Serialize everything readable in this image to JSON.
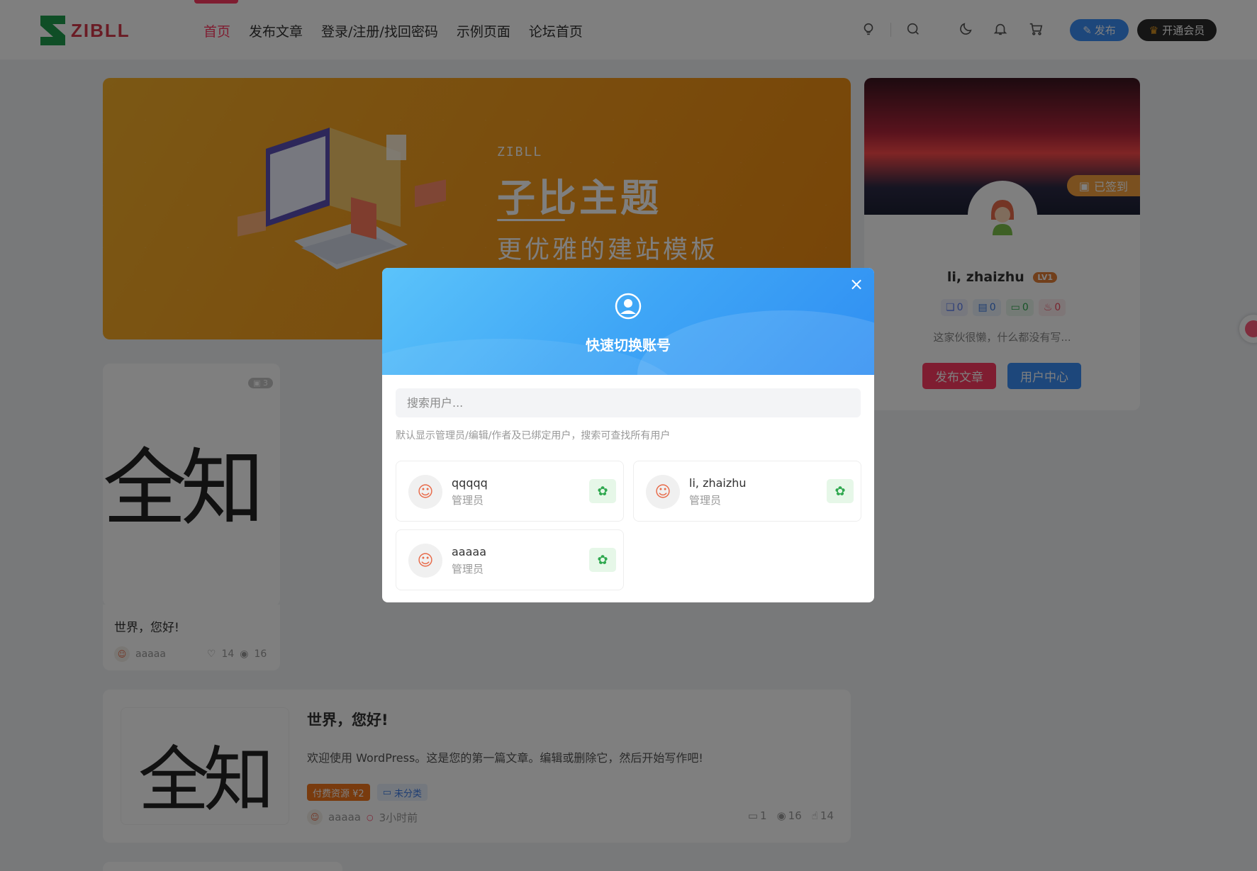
{
  "header": {
    "logo_text": "ZIBLL",
    "nav": [
      {
        "label": "首页",
        "active": true
      },
      {
        "label": "发布文章",
        "active": false
      },
      {
        "label": "登录/注册/找回密码",
        "active": false
      },
      {
        "label": "示例页面",
        "active": false
      },
      {
        "label": "论坛首页",
        "active": false
      }
    ],
    "publish_label": "发布",
    "vip_label": "开通会员",
    "icons": [
      "lightbulb-icon",
      "search-icon",
      "moon-icon",
      "bell-icon",
      "cart-icon"
    ]
  },
  "banner": {
    "brand": "ZIBLL",
    "title": "子比主题",
    "subtitle": "更优雅的建站模板"
  },
  "profile": {
    "checked_in_label": "已签到",
    "name": "li, zhaizhu",
    "level": "LV1",
    "stats": [
      {
        "icon": "comments-icon",
        "value": "0",
        "color": "#5b7cf0",
        "bg": "#eef1fd"
      },
      {
        "icon": "document-icon",
        "value": "0",
        "color": "#3d7be5",
        "bg": "#eaf2fd"
      },
      {
        "icon": "message-icon",
        "value": "0",
        "color": "#2fa84f",
        "bg": "#e8f6ec"
      },
      {
        "icon": "fire-icon",
        "value": "0",
        "color": "#ef4a5e",
        "bg": "#fdecef"
      }
    ],
    "description": "这家伙很懒，什么都没有写...",
    "publish_button": "发布文章",
    "user_center_button": "用户中心"
  },
  "post_card_vertical": {
    "image_count": "3",
    "image_text": "全知",
    "title": "世界，您好!",
    "author": "aaaaa",
    "likes": "14",
    "views": "16"
  },
  "post_card_horizontal": {
    "image_text": "全知",
    "title": "世界，您好!",
    "excerpt": "欢迎使用 WordPress。这是您的第一篇文章。编辑或删除它，然后开始写作吧!",
    "tags": [
      {
        "label": "付费资源 ¥2",
        "bg": "#f3761d",
        "color": "#ffffff"
      },
      {
        "label": "未分类",
        "bg": "#e9f1fd",
        "color": "#3d7be5"
      }
    ],
    "author": "aaaaa",
    "time": "3小时前",
    "comments": "1",
    "views": "16",
    "likes": "14"
  },
  "modal": {
    "title": "快速切换账号",
    "search_placeholder": "搜索用户...",
    "hint": "默认显示管理员/编辑/作者及已绑定用户，搜索可查找所有用户",
    "users": [
      {
        "name": "qqqqq",
        "role": "管理员"
      },
      {
        "name": "li, zhaizhu",
        "role": "管理员"
      },
      {
        "name": "aaaaa",
        "role": "管理员"
      }
    ]
  },
  "colors": {
    "accent": "#ff3a62",
    "primary_blue": "#3a8ef6",
    "banner_orange": "#f5a31e",
    "gear_green": "#2fa84f"
  }
}
